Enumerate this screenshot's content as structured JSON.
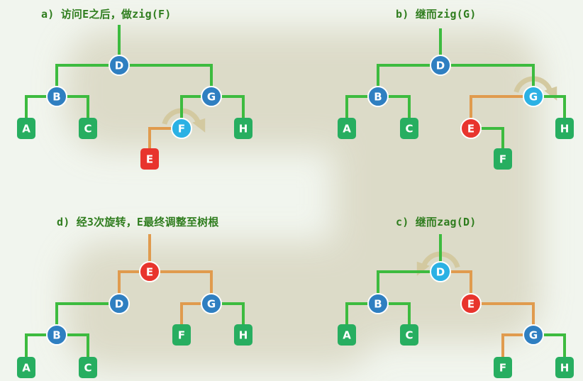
{
  "colors": {
    "background": "#f1f5ee",
    "path_band": "#d9d7c2",
    "edge_green": "#3dbb3f",
    "edge_orange": "#e09b4e",
    "caption": "#2f7d1e",
    "node_internal": "#2f7fc1",
    "node_current": "#2bb1e4",
    "node_accessed": "#e8342d",
    "node_leaf": "#27ae60",
    "rotate_arrow": "#d3c9a0"
  },
  "panels": {
    "a": {
      "caption": "a) 访问E之后，做zig(F)",
      "nodes": [
        {
          "label": "D",
          "kind": "internal"
        },
        {
          "label": "B",
          "kind": "internal"
        },
        {
          "label": "G",
          "kind": "internal"
        },
        {
          "label": "A",
          "kind": "leaf"
        },
        {
          "label": "C",
          "kind": "leaf"
        },
        {
          "label": "F",
          "kind": "current"
        },
        {
          "label": "H",
          "kind": "leaf"
        },
        {
          "label": "E",
          "kind": "accessed"
        }
      ],
      "rotation": "zig",
      "rotate_icon": "rotate-arrow-icon"
    },
    "b": {
      "caption": "b) 继而zig(G)",
      "nodes": [
        {
          "label": "D",
          "kind": "internal"
        },
        {
          "label": "B",
          "kind": "internal"
        },
        {
          "label": "G",
          "kind": "current"
        },
        {
          "label": "A",
          "kind": "leaf"
        },
        {
          "label": "C",
          "kind": "leaf"
        },
        {
          "label": "E",
          "kind": "accessed"
        },
        {
          "label": "H",
          "kind": "leaf"
        },
        {
          "label": "F",
          "kind": "leaf"
        }
      ],
      "rotation": "zig",
      "rotate_icon": "rotate-arrow-icon"
    },
    "c": {
      "caption": "c) 继而zag(D)",
      "nodes": [
        {
          "label": "D",
          "kind": "current"
        },
        {
          "label": "B",
          "kind": "internal"
        },
        {
          "label": "E",
          "kind": "accessed"
        },
        {
          "label": "A",
          "kind": "leaf"
        },
        {
          "label": "C",
          "kind": "leaf"
        },
        {
          "label": "G",
          "kind": "internal"
        },
        {
          "label": "F",
          "kind": "leaf"
        },
        {
          "label": "H",
          "kind": "leaf"
        }
      ],
      "rotation": "zag",
      "rotate_icon": "rotate-arrow-icon"
    },
    "d": {
      "caption": "d) 经3次旋转，E最终调整至树根",
      "nodes": [
        {
          "label": "E",
          "kind": "accessed"
        },
        {
          "label": "D",
          "kind": "internal"
        },
        {
          "label": "G",
          "kind": "internal"
        },
        {
          "label": "B",
          "kind": "internal"
        },
        {
          "label": "F",
          "kind": "leaf"
        },
        {
          "label": "H",
          "kind": "leaf"
        },
        {
          "label": "A",
          "kind": "leaf"
        },
        {
          "label": "C",
          "kind": "leaf"
        }
      ]
    }
  }
}
